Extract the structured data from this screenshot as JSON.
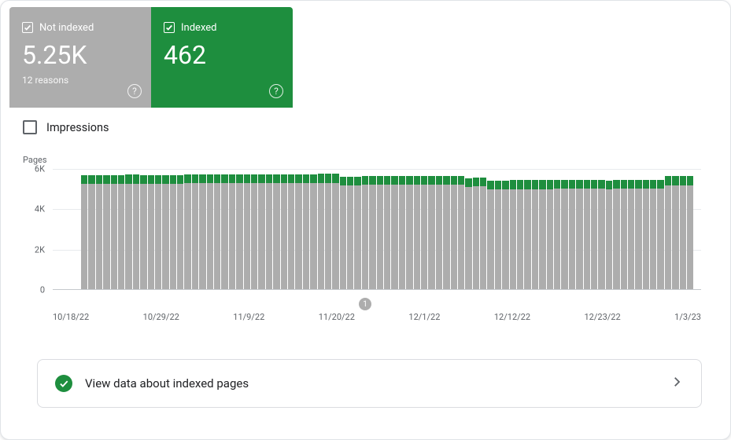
{
  "cards": {
    "notIndexed": {
      "title": "Not indexed",
      "value": "5.25K",
      "sub": "12 reasons"
    },
    "indexed": {
      "title": "Indexed",
      "value": "462"
    }
  },
  "impressions": {
    "label": "Impressions"
  },
  "insight": {
    "label": "View data about indexed pages"
  },
  "annotation": {
    "label": "1"
  },
  "chart_data": {
    "type": "bar",
    "ylabel": "Pages",
    "ylim": [
      0,
      6000
    ],
    "yticks": [
      {
        "value": 0,
        "label": "0"
      },
      {
        "value": 2000,
        "label": "2K"
      },
      {
        "value": 4000,
        "label": "4K"
      },
      {
        "value": 6000,
        "label": "6K"
      }
    ],
    "x_labels": [
      "10/18/22",
      "10/29/22",
      "11/9/22",
      "11/20/22",
      "12/1/22",
      "12/12/22",
      "12/23/22",
      "1/3/23"
    ],
    "series": [
      {
        "name": "Not indexed",
        "color": "#adadad"
      },
      {
        "name": "Indexed",
        "color": "#1e8e3e"
      }
    ],
    "stacks": [
      {
        "notIndexed": 5250,
        "indexed": 430
      },
      {
        "notIndexed": 5250,
        "indexed": 430
      },
      {
        "notIndexed": 5250,
        "indexed": 430
      },
      {
        "notIndexed": 5250,
        "indexed": 430
      },
      {
        "notIndexed": 5250,
        "indexed": 430
      },
      {
        "notIndexed": 5260,
        "indexed": 430
      },
      {
        "notIndexed": 5260,
        "indexed": 450
      },
      {
        "notIndexed": 5260,
        "indexed": 450
      },
      {
        "notIndexed": 5260,
        "indexed": 440
      },
      {
        "notIndexed": 5260,
        "indexed": 440
      },
      {
        "notIndexed": 5260,
        "indexed": 440
      },
      {
        "notIndexed": 5260,
        "indexed": 440
      },
      {
        "notIndexed": 5260,
        "indexed": 440
      },
      {
        "notIndexed": 5260,
        "indexed": 440
      },
      {
        "notIndexed": 5280,
        "indexed": 440
      },
      {
        "notIndexed": 5280,
        "indexed": 440
      },
      {
        "notIndexed": 5280,
        "indexed": 440
      },
      {
        "notIndexed": 5280,
        "indexed": 440
      },
      {
        "notIndexed": 5280,
        "indexed": 440
      },
      {
        "notIndexed": 5280,
        "indexed": 440
      },
      {
        "notIndexed": 5280,
        "indexed": 440
      },
      {
        "notIndexed": 5280,
        "indexed": 440
      },
      {
        "notIndexed": 5280,
        "indexed": 440
      },
      {
        "notIndexed": 5280,
        "indexed": 440
      },
      {
        "notIndexed": 5280,
        "indexed": 440
      },
      {
        "notIndexed": 5280,
        "indexed": 440
      },
      {
        "notIndexed": 5280,
        "indexed": 440
      },
      {
        "notIndexed": 5300,
        "indexed": 430
      },
      {
        "notIndexed": 5300,
        "indexed": 430
      },
      {
        "notIndexed": 5300,
        "indexed": 430
      },
      {
        "notIndexed": 5300,
        "indexed": 430
      },
      {
        "notIndexed": 5300,
        "indexed": 430
      },
      {
        "notIndexed": 5300,
        "indexed": 450
      },
      {
        "notIndexed": 5300,
        "indexed": 450
      },
      {
        "notIndexed": 5300,
        "indexed": 450
      },
      {
        "notIndexed": 5180,
        "indexed": 430
      },
      {
        "notIndexed": 5200,
        "indexed": 430
      },
      {
        "notIndexed": 5200,
        "indexed": 430
      },
      {
        "notIndexed": 5220,
        "indexed": 430
      },
      {
        "notIndexed": 5220,
        "indexed": 430
      },
      {
        "notIndexed": 5220,
        "indexed": 430
      },
      {
        "notIndexed": 5220,
        "indexed": 430
      },
      {
        "notIndexed": 5220,
        "indexed": 430
      },
      {
        "notIndexed": 5220,
        "indexed": 430
      },
      {
        "notIndexed": 5220,
        "indexed": 430
      },
      {
        "notIndexed": 5220,
        "indexed": 430
      },
      {
        "notIndexed": 5220,
        "indexed": 430
      },
      {
        "notIndexed": 5220,
        "indexed": 430
      },
      {
        "notIndexed": 5220,
        "indexed": 430
      },
      {
        "notIndexed": 5220,
        "indexed": 430
      },
      {
        "notIndexed": 5220,
        "indexed": 430
      },
      {
        "notIndexed": 5220,
        "indexed": 430
      },
      {
        "notIndexed": 5100,
        "indexed": 420
      },
      {
        "notIndexed": 5150,
        "indexed": 420
      },
      {
        "notIndexed": 5150,
        "indexed": 420
      },
      {
        "notIndexed": 5000,
        "indexed": 410
      },
      {
        "notIndexed": 5000,
        "indexed": 430
      },
      {
        "notIndexed": 5000,
        "indexed": 430
      },
      {
        "notIndexed": 5000,
        "indexed": 440
      },
      {
        "notIndexed": 5000,
        "indexed": 440
      },
      {
        "notIndexed": 5000,
        "indexed": 440
      },
      {
        "notIndexed": 5000,
        "indexed": 440
      },
      {
        "notIndexed": 5000,
        "indexed": 440
      },
      {
        "notIndexed": 5000,
        "indexed": 440
      },
      {
        "notIndexed": 5030,
        "indexed": 440
      },
      {
        "notIndexed": 5030,
        "indexed": 440
      },
      {
        "notIndexed": 5030,
        "indexed": 440
      },
      {
        "notIndexed": 5030,
        "indexed": 440
      },
      {
        "notIndexed": 5030,
        "indexed": 440
      },
      {
        "notIndexed": 5030,
        "indexed": 440
      },
      {
        "notIndexed": 5030,
        "indexed": 440
      },
      {
        "notIndexed": 4980,
        "indexed": 420
      },
      {
        "notIndexed": 5030,
        "indexed": 440
      },
      {
        "notIndexed": 5030,
        "indexed": 440
      },
      {
        "notIndexed": 5030,
        "indexed": 440
      },
      {
        "notIndexed": 5030,
        "indexed": 440
      },
      {
        "notIndexed": 5030,
        "indexed": 440
      },
      {
        "notIndexed": 5030,
        "indexed": 440
      },
      {
        "notIndexed": 5030,
        "indexed": 440
      },
      {
        "notIndexed": 5180,
        "indexed": 462
      },
      {
        "notIndexed": 5200,
        "indexed": 462
      },
      {
        "notIndexed": 5200,
        "indexed": 462
      },
      {
        "notIndexed": 5200,
        "indexed": 462
      }
    ]
  }
}
